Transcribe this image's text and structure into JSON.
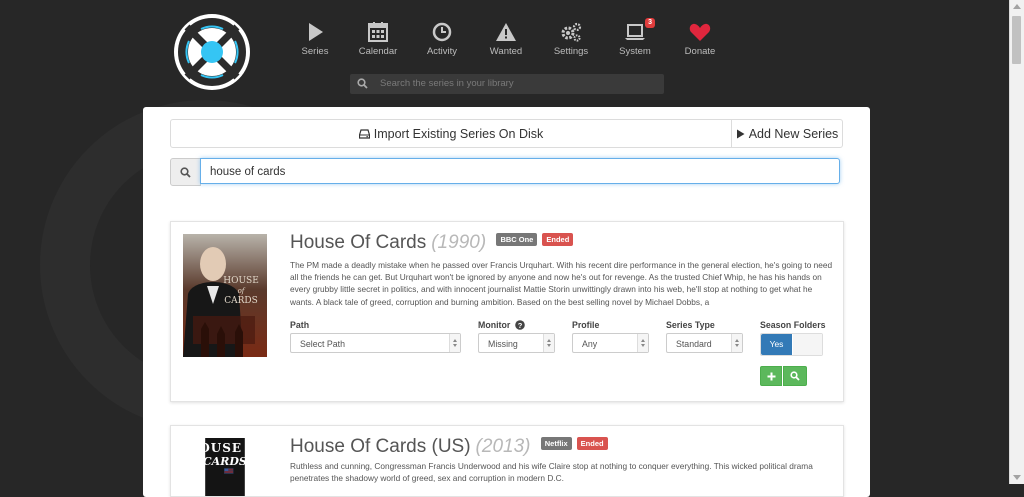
{
  "nav": {
    "items": [
      {
        "label": "Series",
        "icon": "play-icon"
      },
      {
        "label": "Calendar",
        "icon": "calendar-icon"
      },
      {
        "label": "Activity",
        "icon": "clock-icon"
      },
      {
        "label": "Wanted",
        "icon": "warning-icon"
      },
      {
        "label": "Settings",
        "icon": "gears-icon"
      },
      {
        "label": "System",
        "icon": "laptop-icon",
        "badge": "3"
      },
      {
        "label": "Donate",
        "icon": "heart-icon"
      }
    ],
    "search_placeholder": "Search the series in your library"
  },
  "actions": {
    "import_label": "Import Existing Series On Disk",
    "add_new_label": "Add New Series"
  },
  "search": {
    "value": "house of cards"
  },
  "results": [
    {
      "title": "House Of Cards",
      "year": "(1990)",
      "network": "BBC One",
      "status": "Ended",
      "overview": "The PM made a deadly mistake when he passed over Francis Urquhart. With his recent dire performance in the general election, he's going to need all the friends he can get. But Urquhart won't be ignored by anyone and now he's out for revenge. As the trusted Chief Whip, he has his hands on every grubby little secret in politics, and with innocent journalist Mattie Storin unwittingly drawn into his web, he'll stop at nothing to get what he wants. A black tale of greed, corruption and burning ambition. Based on the best selling novel by Michael Dobbs, a",
      "poster_text": [
        "HOUSE",
        "of",
        "CARDS"
      ],
      "fields": {
        "path_label": "Path",
        "path_value": "Select Path",
        "monitor_label": "Monitor",
        "monitor_value": "Missing",
        "profile_label": "Profile",
        "profile_value": "Any",
        "series_type_label": "Series Type",
        "series_type_value": "Standard",
        "season_folders_label": "Season Folders",
        "season_folders_value": "Yes"
      }
    },
    {
      "title": "House Of Cards (US)",
      "year": "(2013)",
      "network": "Netflix",
      "status": "Ended",
      "overview": "Ruthless and cunning, Congressman Francis Underwood and his wife Claire stop at nothing to conquer everything. This wicked political drama penetrates the shadowy world of greed, sex and corruption in modern D.C.",
      "poster_text": [
        "HOUSE",
        "of CARDS"
      ]
    }
  ],
  "colors": {
    "header_bg": "#272727",
    "accent_blue": "#337ab7",
    "success_green": "#5cb85c",
    "danger_red": "#d9534f",
    "logo_blue": "#35c5f4",
    "heart_red": "#e0263d"
  }
}
